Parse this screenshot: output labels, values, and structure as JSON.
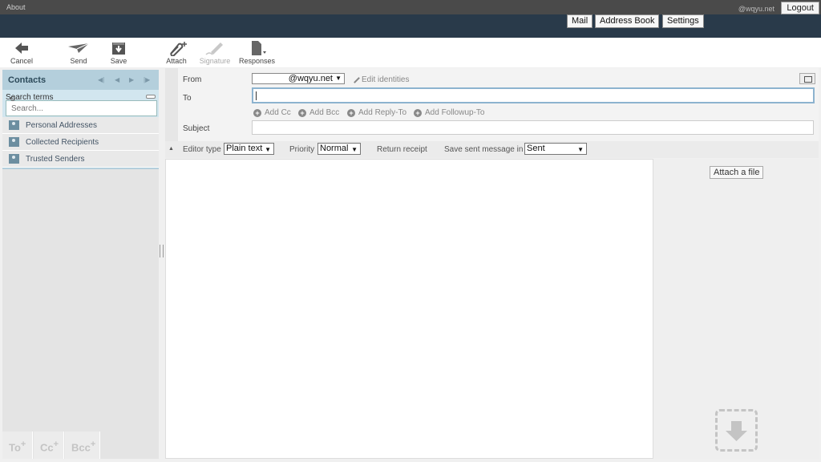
{
  "topbar": {
    "about": "About",
    "user": "@wqyu.net",
    "logout": "Logout"
  },
  "header": {
    "nav": [
      "Mail",
      "Address Book",
      "Settings"
    ]
  },
  "toolbar": {
    "cancel": "Cancel",
    "send": "Send",
    "save": "Save",
    "attach": "Attach",
    "signature": "Signature",
    "responses": "Responses"
  },
  "contacts": {
    "title": "Contacts",
    "search_label": "Search terms",
    "search_placeholder": "Search...",
    "addressbooks": [
      "Personal Addresses",
      "Collected Recipients",
      "Trusted Senders"
    ],
    "footer": {
      "to": "To",
      "cc": "Cc",
      "bcc": "Bcc"
    }
  },
  "compose": {
    "from_label": "From",
    "from_value": "@wqyu.net",
    "edit_identities": "Edit identities",
    "to_label": "To",
    "to_value": "",
    "add_cc": "Add Cc",
    "add_bcc": "Add Bcc",
    "add_reply_to": "Add Reply-To",
    "add_followup_to": "Add Followup-To",
    "subject_label": "Subject",
    "subject_value": ""
  },
  "options": {
    "editor_type_label": "Editor type",
    "editor_type_value": "Plain text",
    "priority_label": "Priority",
    "priority_value": "Normal",
    "return_receipt_label": "Return receipt",
    "save_sent_label": "Save sent message in",
    "save_sent_value": "Sent"
  },
  "attachments": {
    "attach_file": "Attach a file"
  },
  "colors": {
    "header_bg": "#293a4a",
    "topbar_bg": "#4a4a4a",
    "contacts_head": "#b4cfdc",
    "accent_focus": "#8db3cf"
  }
}
